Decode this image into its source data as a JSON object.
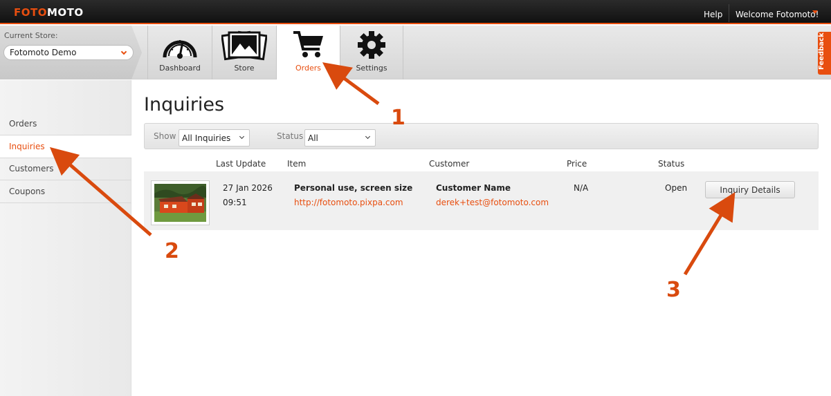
{
  "topbar": {
    "logo_part1": "FOTO",
    "logo_part2": "MOTO",
    "help": "Help",
    "welcome": "Welcome Fotomoto!"
  },
  "store": {
    "label": "Current Store:",
    "selected": "Fotomoto Demo"
  },
  "nav_tabs": [
    {
      "label": "Dashboard",
      "icon": "dashboard-gauge-icon"
    },
    {
      "label": "Store",
      "icon": "store-photos-icon"
    },
    {
      "label": "Orders",
      "icon": "shopping-cart-icon"
    },
    {
      "label": "Settings",
      "icon": "gear-icon"
    }
  ],
  "feedback": "Feedback",
  "sidebar": {
    "items": [
      {
        "label": "Orders"
      },
      {
        "label": "Inquiries"
      },
      {
        "label": "Customers"
      },
      {
        "label": "Coupons"
      }
    ]
  },
  "main": {
    "title": "Inquiries",
    "filters": {
      "show_label": "Show",
      "show_value": "All Inquiries",
      "status_label": "Status",
      "status_value": "All"
    },
    "table": {
      "headers": [
        "Last Update",
        "Item",
        "Customer",
        "Price",
        "Status"
      ],
      "rows": [
        {
          "date": "27 Jan 2026",
          "time": "09:51",
          "item_title": "Personal use, screen size",
          "item_url": "http://fotomoto.pixpa.com",
          "customer_name": "Customer Name",
          "customer_email": "derek+test@fotomoto.com",
          "price": "N/A",
          "status": "Open",
          "action": "Inquiry Details"
        }
      ]
    }
  },
  "annotations": [
    "1",
    "2",
    "3"
  ],
  "colors": {
    "accent": "#e84e0f",
    "annotation": "#d94a0e"
  }
}
